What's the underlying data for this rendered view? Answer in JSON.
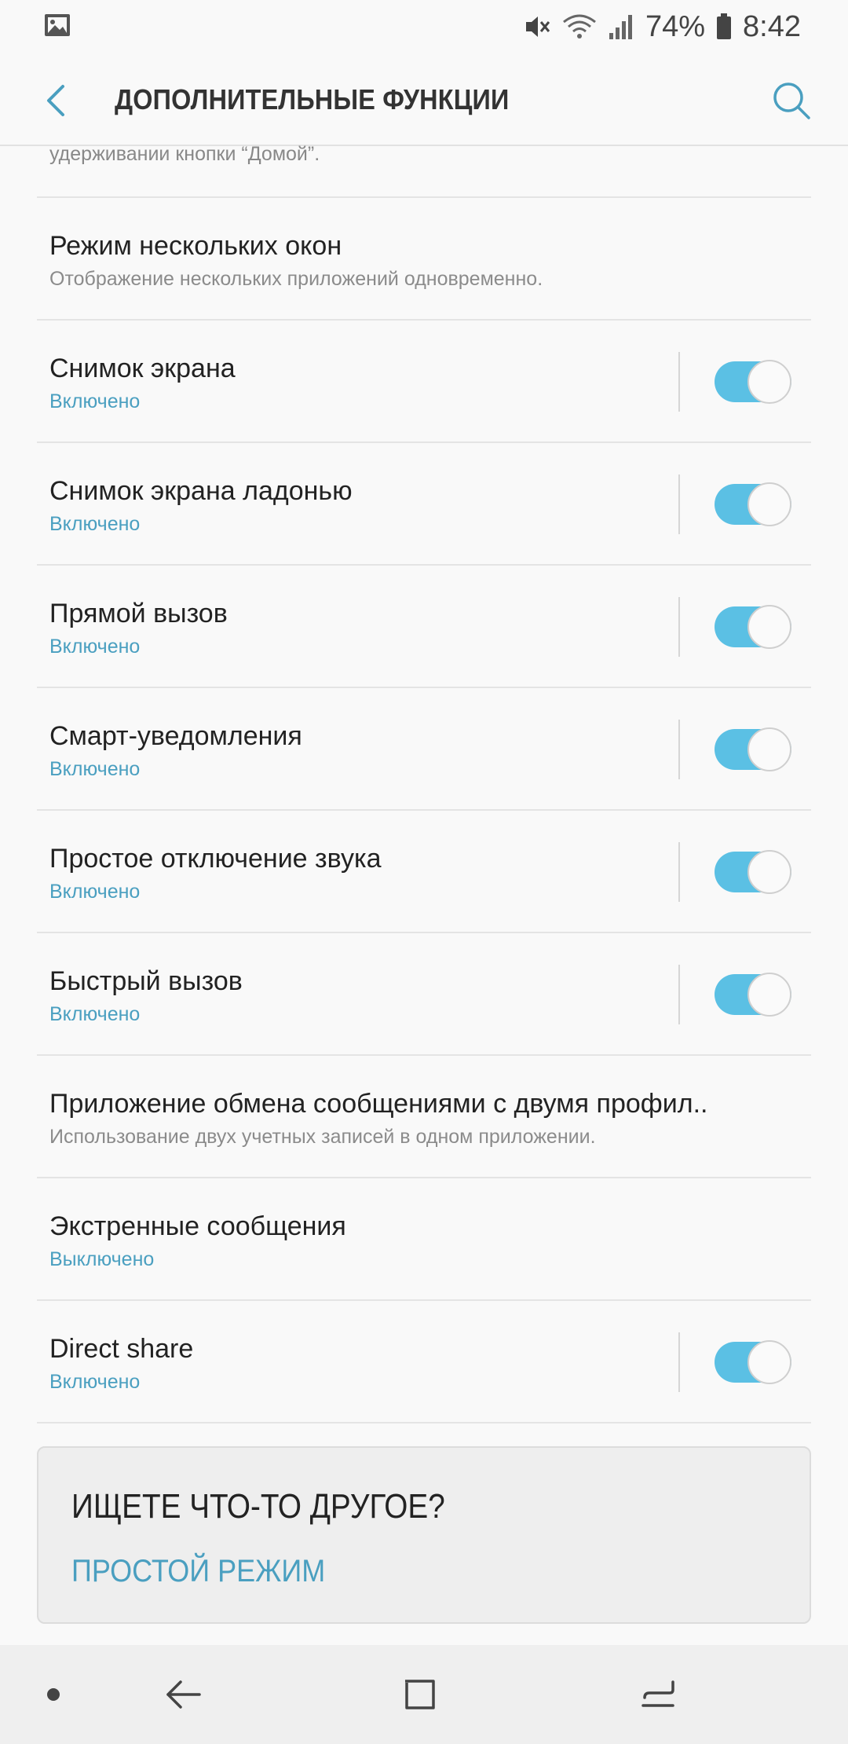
{
  "status_bar": {
    "battery_percent": "74%",
    "time": "8:42",
    "icons": [
      "gallery-icon",
      "mute-icon",
      "wifi-icon",
      "signal-icon",
      "battery-icon"
    ]
  },
  "app_bar": {
    "title": "ДОПОЛНИТЕЛЬНЫЕ ФУНКЦИИ",
    "back_icon": "back-arrow-icon",
    "search_icon": "search-icon"
  },
  "previous_item_tail": "удерживании кнопки “Домой”.",
  "items": [
    {
      "title": "Режим нескольких окон",
      "subtitle": "Отображение нескольких приложений одновременно.",
      "subtitle_style": "grey",
      "toggle": null
    },
    {
      "title": "Снимок экрана",
      "subtitle": "Включено",
      "subtitle_style": "blue",
      "toggle": true
    },
    {
      "title": "Снимок экрана ладонью",
      "subtitle": "Включено",
      "subtitle_style": "blue",
      "toggle": true
    },
    {
      "title": "Прямой вызов",
      "subtitle": "Включено",
      "subtitle_style": "blue",
      "toggle": true
    },
    {
      "title": "Смарт-уведомления",
      "subtitle": "Включено",
      "subtitle_style": "blue",
      "toggle": true
    },
    {
      "title": "Простое отключение звука",
      "subtitle": "Включено",
      "subtitle_style": "blue",
      "toggle": true
    },
    {
      "title": "Быстрый вызов",
      "subtitle": "Включено",
      "subtitle_style": "blue",
      "toggle": true
    },
    {
      "title": "Приложение обмена сообщениями с двумя профил..",
      "subtitle": "Использование двух учетных записей в одном приложении.",
      "subtitle_style": "grey",
      "toggle": null
    },
    {
      "title": "Экстренные сообщения",
      "subtitle": "Выключено",
      "subtitle_style": "blue",
      "toggle": null
    },
    {
      "title": "Direct share",
      "subtitle": "Включено",
      "subtitle_style": "blue",
      "toggle": true
    }
  ],
  "suggestion_card": {
    "title": "ИЩЕТЕ ЧТО-ТО ДРУГОЕ?",
    "link": "ПРОСТОЙ РЕЖИМ"
  },
  "nav_bar": {
    "icons": [
      "dot-icon",
      "back-icon",
      "home-icon",
      "recents-icon"
    ]
  },
  "colors": {
    "accent": "#4a9fc0",
    "toggle_on": "#5bc0e4",
    "background": "#f9f9f9"
  }
}
